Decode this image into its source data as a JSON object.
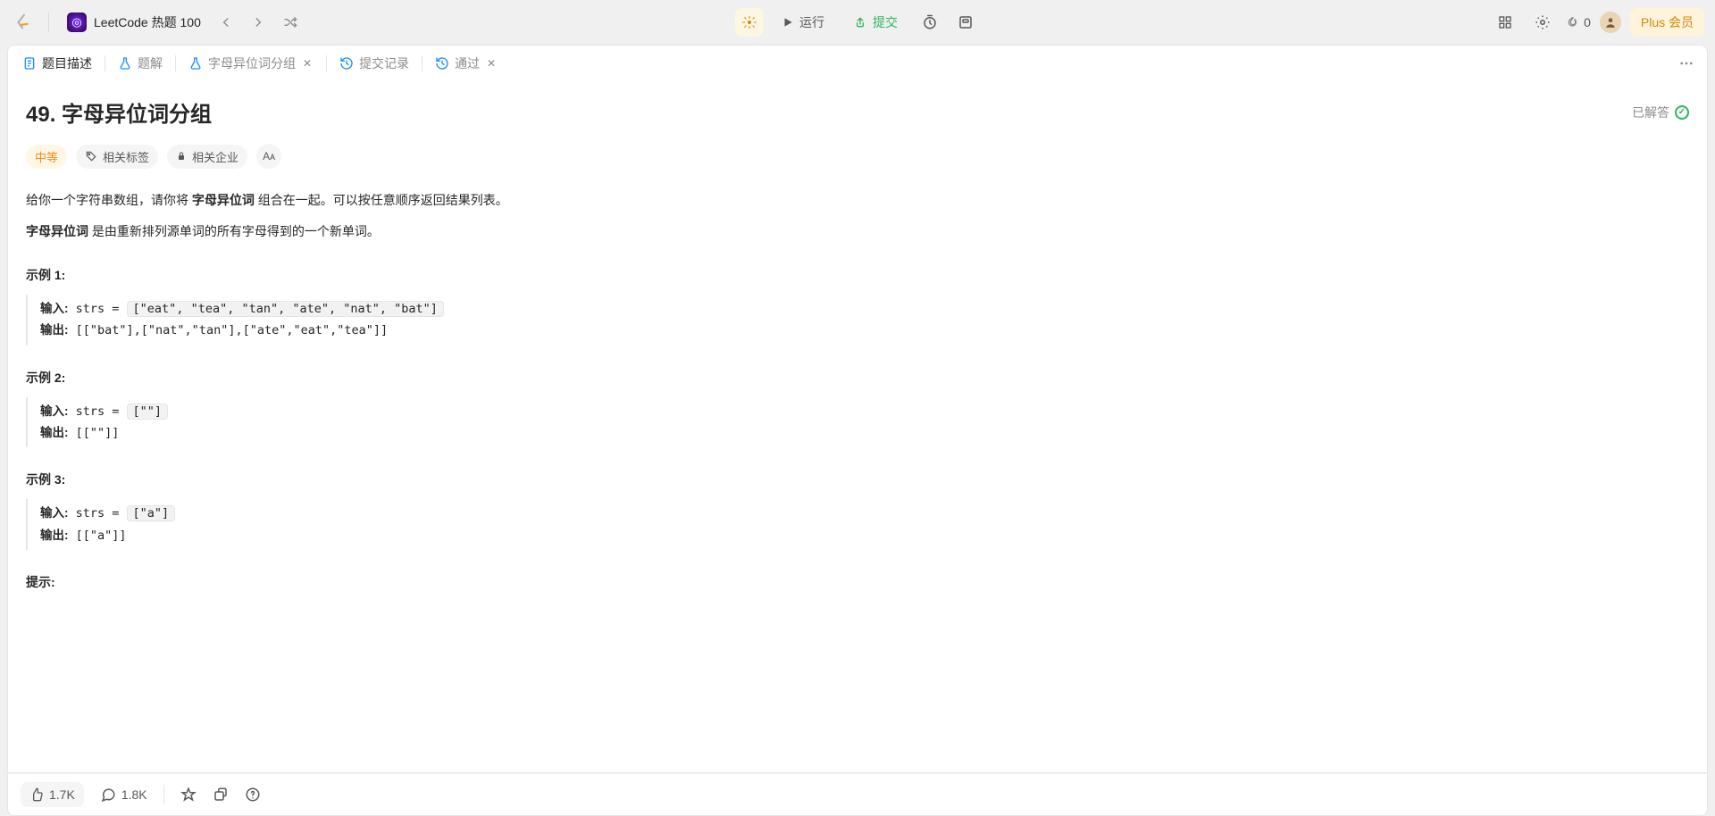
{
  "appbar": {
    "playlist_title": "LeetCode 热题 100",
    "run_label": "运行",
    "submit_label": "提交",
    "streak_count": "0",
    "premium_label": "Plus 会员"
  },
  "tabs": {
    "description": "题目描述",
    "editorial": "题解",
    "note": "字母异位词分组",
    "submissions": "提交记录",
    "accepted": "通过"
  },
  "problem": {
    "title": "49. 字母异位词分组",
    "solved_label": "已解答",
    "difficulty": "中等",
    "tags_label": "相关标签",
    "companies_label": "相关企业",
    "text_size_label": "Aᴀ",
    "desc_p1_a": "给你一个字符串数组，请你将 ",
    "desc_p1_b": "字母异位词",
    "desc_p1_c": " 组合在一起。可以按任意顺序返回结果列表。",
    "desc_p2_a": "字母异位词",
    "desc_p2_b": " 是由重新排列源单词的所有字母得到的一个新单词。",
    "hints_heading": "提示:",
    "example_heading_prefix": "示例",
    "input_label": "输入:",
    "output_label": "输出:",
    "examples": [
      {
        "num": "1",
        "input_prefix": "strs = ",
        "input_boxed": "[\"eat\", \"tea\", \"tan\", \"ate\", \"nat\", \"bat\"]",
        "output": "[[\"bat\"],[\"nat\",\"tan\"],[\"ate\",\"eat\",\"tea\"]]"
      },
      {
        "num": "2",
        "input_prefix": "strs = ",
        "input_boxed": "[\"\"]",
        "output": "[[\"\"]]"
      },
      {
        "num": "3",
        "input_prefix": "strs = ",
        "input_boxed": "[\"a\"]",
        "output": "[[\"a\"]]"
      }
    ]
  },
  "footer": {
    "likes": "1.7K",
    "comments": "1.8K"
  }
}
